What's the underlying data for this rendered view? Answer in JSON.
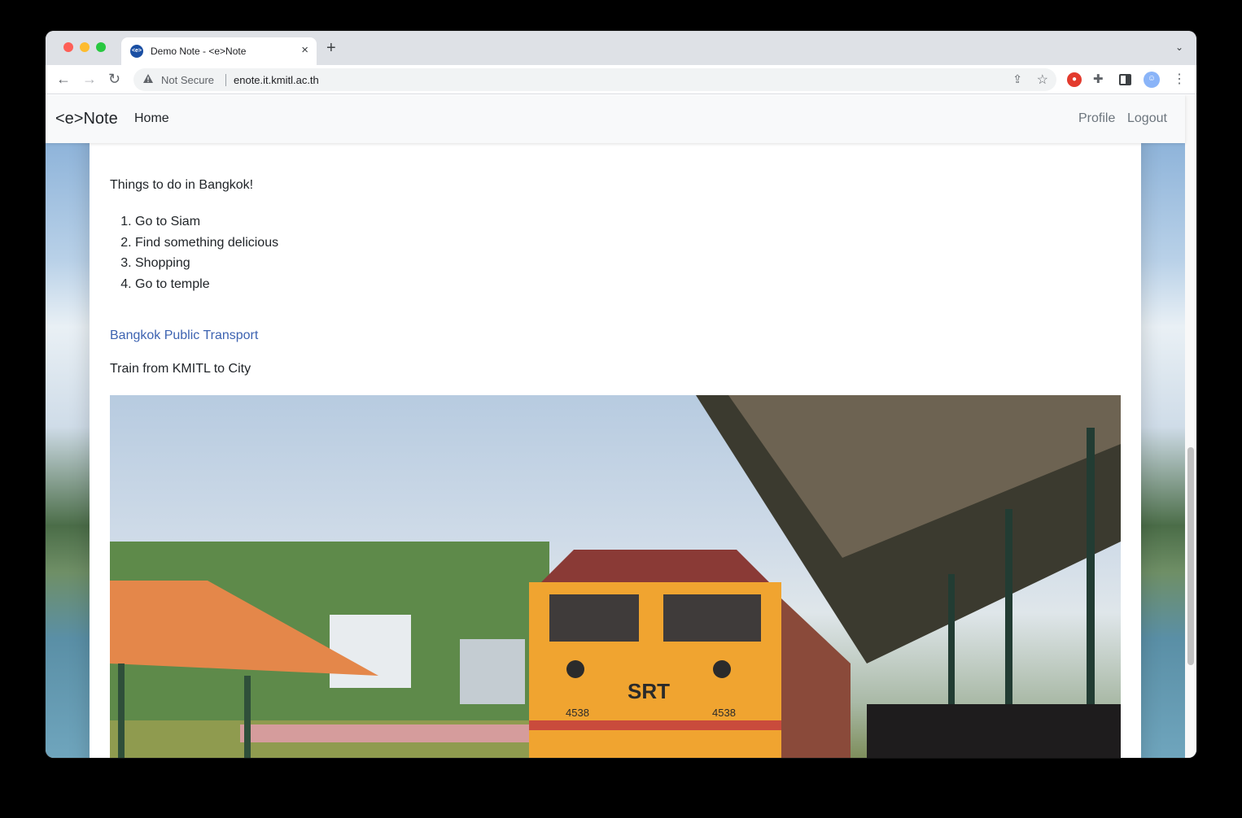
{
  "browser": {
    "tab_title": "Demo Note - <e>Note",
    "tab_favicon_text": "<e>",
    "close_glyph": "×",
    "new_tab_glyph": "+",
    "tabs_menu_glyph": "⌄",
    "back_glyph": "←",
    "forward_glyph": "→",
    "reload_glyph": "↻",
    "security_label": "Not Secure",
    "url": "enote.it.kmitl.ac.th",
    "share_glyph": "⇪",
    "star_glyph": "☆",
    "menu_glyph": "⋮"
  },
  "navbar": {
    "brand": "<e>Note",
    "home": "Home",
    "profile": "Profile",
    "logout": "Logout"
  },
  "note": {
    "heading": "Things to do in Bangkok!",
    "items": [
      "Go to Siam",
      "Find something delicious",
      "Shopping",
      "Go to temple"
    ],
    "link_text": "Bangkok Public Transport",
    "caption": "Train from KMITL to City",
    "locomotive_logo": "SRT",
    "locomotive_number": "4538"
  },
  "colors": {
    "link": "#3d63b1",
    "nav_muted": "#6c757d",
    "locomotive_orange": "#f0a430",
    "roof_orange": "#e4874a"
  }
}
